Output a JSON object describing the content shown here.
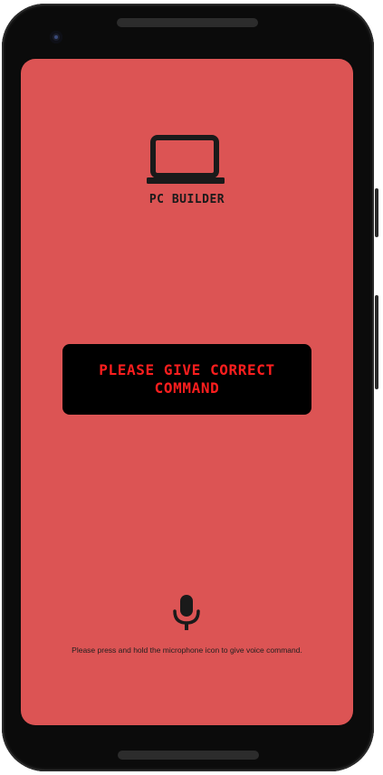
{
  "app": {
    "title": "PC BUILDER",
    "logo_icon": "laptop-icon"
  },
  "message": {
    "text": "PLEASE GIVE CORRECT COMMAND",
    "color": "#ff1e1e",
    "background": "#000000"
  },
  "voice": {
    "icon": "microphone-icon",
    "hint": "Please press and hold the microphone icon to give voice command."
  },
  "theme": {
    "screen_background": "#dc5454",
    "icon_color": "#1a1a1a"
  }
}
